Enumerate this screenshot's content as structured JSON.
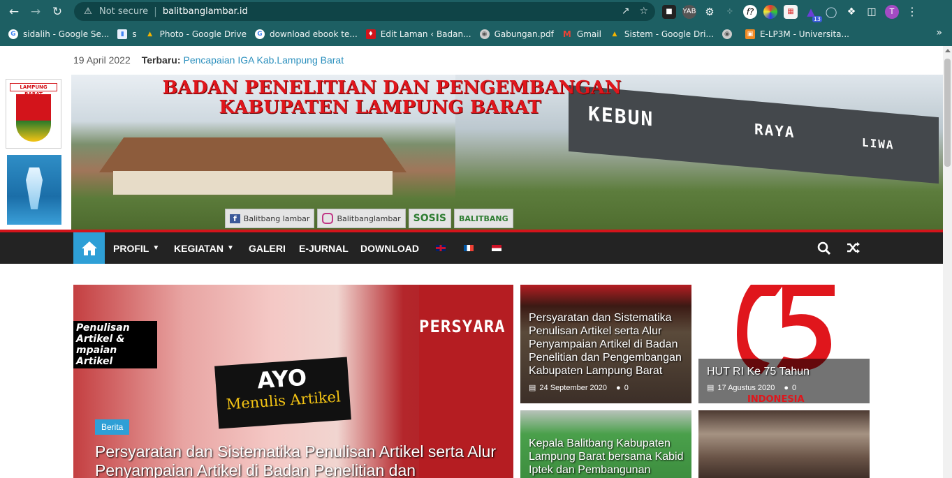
{
  "browser": {
    "security_label": "Not secure",
    "url": "balitbanglambar.id",
    "extension_badge": "13",
    "profile_initial": "T",
    "bookmarks": [
      {
        "label": "sidalih - Google Se...",
        "icon": "google-icon",
        "color": "#ffffff"
      },
      {
        "label": "s",
        "icon": "file-icon",
        "color": "#e8f0fe"
      },
      {
        "label": "Photo - Google Drive",
        "icon": "drive-icon",
        "color": "#f4b400"
      },
      {
        "label": "download ebook te...",
        "icon": "google-icon",
        "color": "#ffffff"
      },
      {
        "label": "Edit Laman ‹ Badan...",
        "icon": "site-icon",
        "color": "#d3141b"
      },
      {
        "label": "Gabungan.pdf",
        "icon": "globe-icon",
        "color": "#cccccc"
      },
      {
        "label": "Gmail",
        "icon": "gmail-icon",
        "color": "#ea4335"
      },
      {
        "label": "Sistem - Google Dri...",
        "icon": "drive-icon",
        "color": "#f4b400"
      },
      {
        "label": "",
        "icon": "globe-icon",
        "color": "#cccccc"
      },
      {
        "label": "E-LP3M - Universita...",
        "icon": "univ-icon",
        "color": "#f08a24"
      }
    ]
  },
  "site": {
    "date": "19 April 2022",
    "latest_label": "Terbaru:",
    "latest_title": "Pencapaian IGA Kab.Lampung Barat",
    "logo_text": "LAMPUNG BARAT",
    "banner": {
      "line1": "BADAN PENELITIAN DAN PENGEMBANGAN",
      "line2": "KABUPATEN LAMPUNG BARAT",
      "sign_words": [
        "KEBUN",
        "RAYA",
        "LIWA"
      ],
      "social": [
        "Balitbang lambar",
        "Balitbanglambar",
        "SOSIS",
        "BALITBANG"
      ]
    },
    "menu": [
      {
        "label": "PROFIL",
        "dropdown": true
      },
      {
        "label": "KEGIATAN",
        "dropdown": true
      },
      {
        "label": "GALERI",
        "dropdown": false
      },
      {
        "label": "E-JURNAL",
        "dropdown": false
      },
      {
        "label": "DOWNLOAD",
        "dropdown": false
      }
    ]
  },
  "posts": {
    "hero": {
      "category": "Berita",
      "title": "Persyaratan dan Sistematika Penulisan Artikel serta Alur Penyampaian Artikel di Badan Penelitian dan",
      "image_text_ayo": "AYO",
      "image_text_menulis": "Menulis Artikel",
      "image_text_persy": "PERSYARA",
      "image_text_left": "Penulisan Artikel & mpaian Artikel"
    },
    "side": [
      {
        "title": "Persyaratan dan Sistematika Penulisan Artikel serta Alur Penyampaian Artikel di Badan Penelitian dan Pengembangan Kabupaten Lampung Barat",
        "date": "24 September 2020",
        "comments": "0"
      },
      {
        "title": "HUT RI Ke 75 Tahun",
        "date": "17 Agustus 2020",
        "comments": "0",
        "image_text": "INDONESIA"
      },
      {
        "title": "Kepala Balitbang Kabupaten Lampung Barat bersama Kabid Iptek dan Pembangunan"
      },
      {
        "title": ""
      }
    ]
  },
  "colors": {
    "chrome": "#1d5f63",
    "accent": "#2e9fd6",
    "brand_red": "#d3141b",
    "nav": "#232323"
  }
}
